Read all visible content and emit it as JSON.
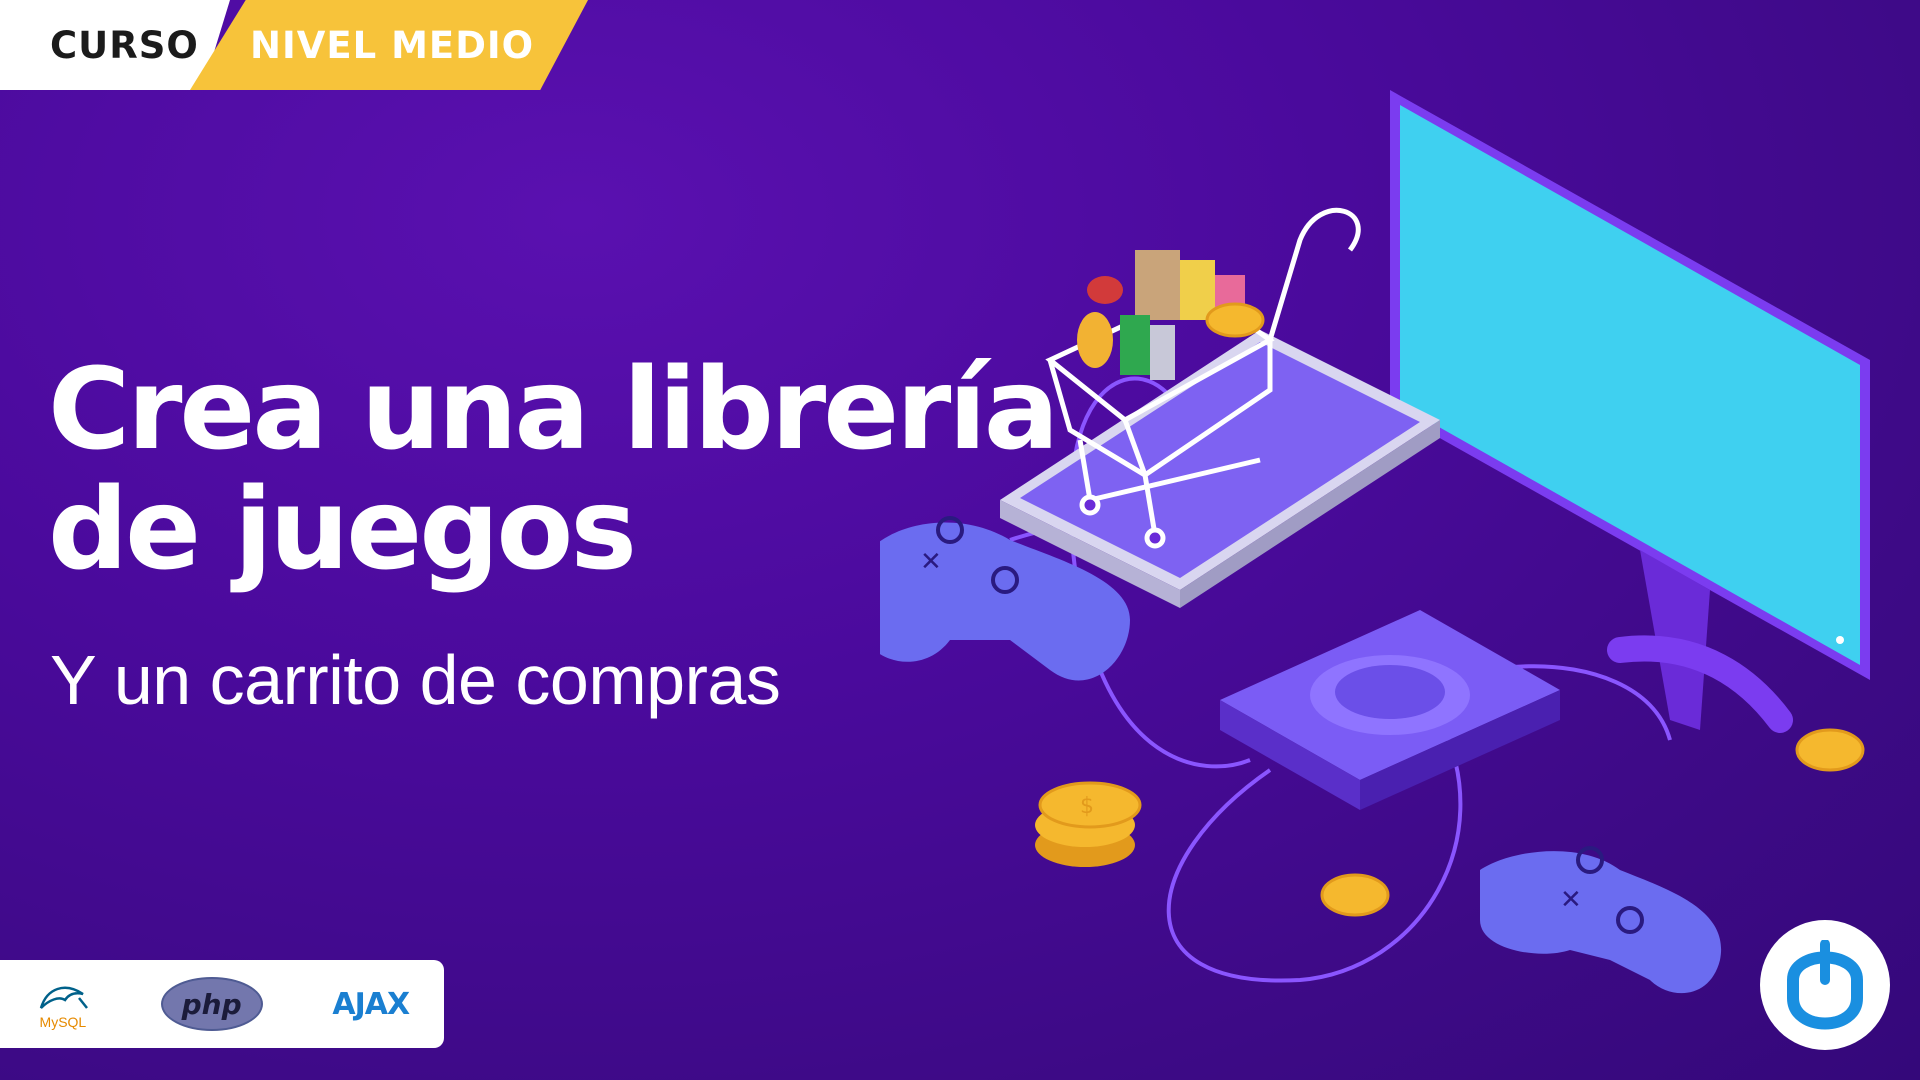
{
  "badges": {
    "curso": "CURSO",
    "nivel": "NIVEL MEDIO"
  },
  "title": {
    "line1": "Crea una librería",
    "line2": "de juegos"
  },
  "subtitle": "Y un carrito de compras",
  "technologies": [
    {
      "name": "MySQL",
      "icon": "mysql-dolphin-icon"
    },
    {
      "name": "php",
      "icon": "php-logo"
    },
    {
      "name": "AJAX",
      "icon": "ajax-logo"
    }
  ],
  "colors": {
    "background": "#4a0a9c",
    "badge_curso_bg": "#ffffff",
    "badge_nivel_bg": "#f7c33a",
    "monitor_screen": "#3fd0f0",
    "coin": "#f5b82e",
    "controller": "#6b6cf0",
    "brand_logo": "#1a8fe0"
  },
  "illustration": {
    "elements": [
      "monitor-icon",
      "smartphone-icon",
      "shopping-cart-icon",
      "game-controller-icon",
      "game-console-icon",
      "coin-icon"
    ],
    "coin_symbol": "$"
  }
}
